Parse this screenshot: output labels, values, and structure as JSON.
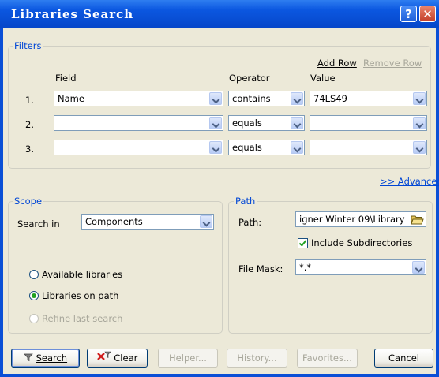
{
  "window": {
    "title": "Libraries Search",
    "help_glyph": "?",
    "close_glyph": "✕"
  },
  "filters": {
    "legend": "Filters",
    "add_row": "Add Row",
    "remove_row": "Remove Row",
    "headers": {
      "field": "Field",
      "operator": "Operator",
      "value": "Value"
    },
    "rows": [
      {
        "num": "1.",
        "field": "Name",
        "operator": "contains",
        "value": "74LS49"
      },
      {
        "num": "2.",
        "field": "",
        "operator": "equals",
        "value": ""
      },
      {
        "num": "3.",
        "field": "",
        "operator": "equals",
        "value": ""
      }
    ]
  },
  "advanced_link": ">> Advanced",
  "scope": {
    "legend": "Scope",
    "search_in_label": "Search in",
    "search_in_value": "Components",
    "options": [
      {
        "label": "Available libraries",
        "checked": false,
        "enabled": true
      },
      {
        "label": "Libraries on path",
        "checked": true,
        "enabled": true
      },
      {
        "label": "Refine last search",
        "checked": false,
        "enabled": false
      }
    ]
  },
  "path": {
    "legend": "Path",
    "path_label": "Path:",
    "path_value": "igner Winter 09\\Library",
    "include_subdirs_label": "Include Subdirectories",
    "include_subdirs_checked": true,
    "file_mask_label": "File Mask:",
    "file_mask_value": "*.*"
  },
  "buttons": {
    "search": "Search",
    "clear": "Clear",
    "helper": "Helper...",
    "history": "History...",
    "favorites": "Favorites...",
    "cancel": "Cancel"
  },
  "colors": {
    "accent": "#0046d5",
    "title_bar": "#0b57e0",
    "dialog_bg": "#ece9d8"
  }
}
